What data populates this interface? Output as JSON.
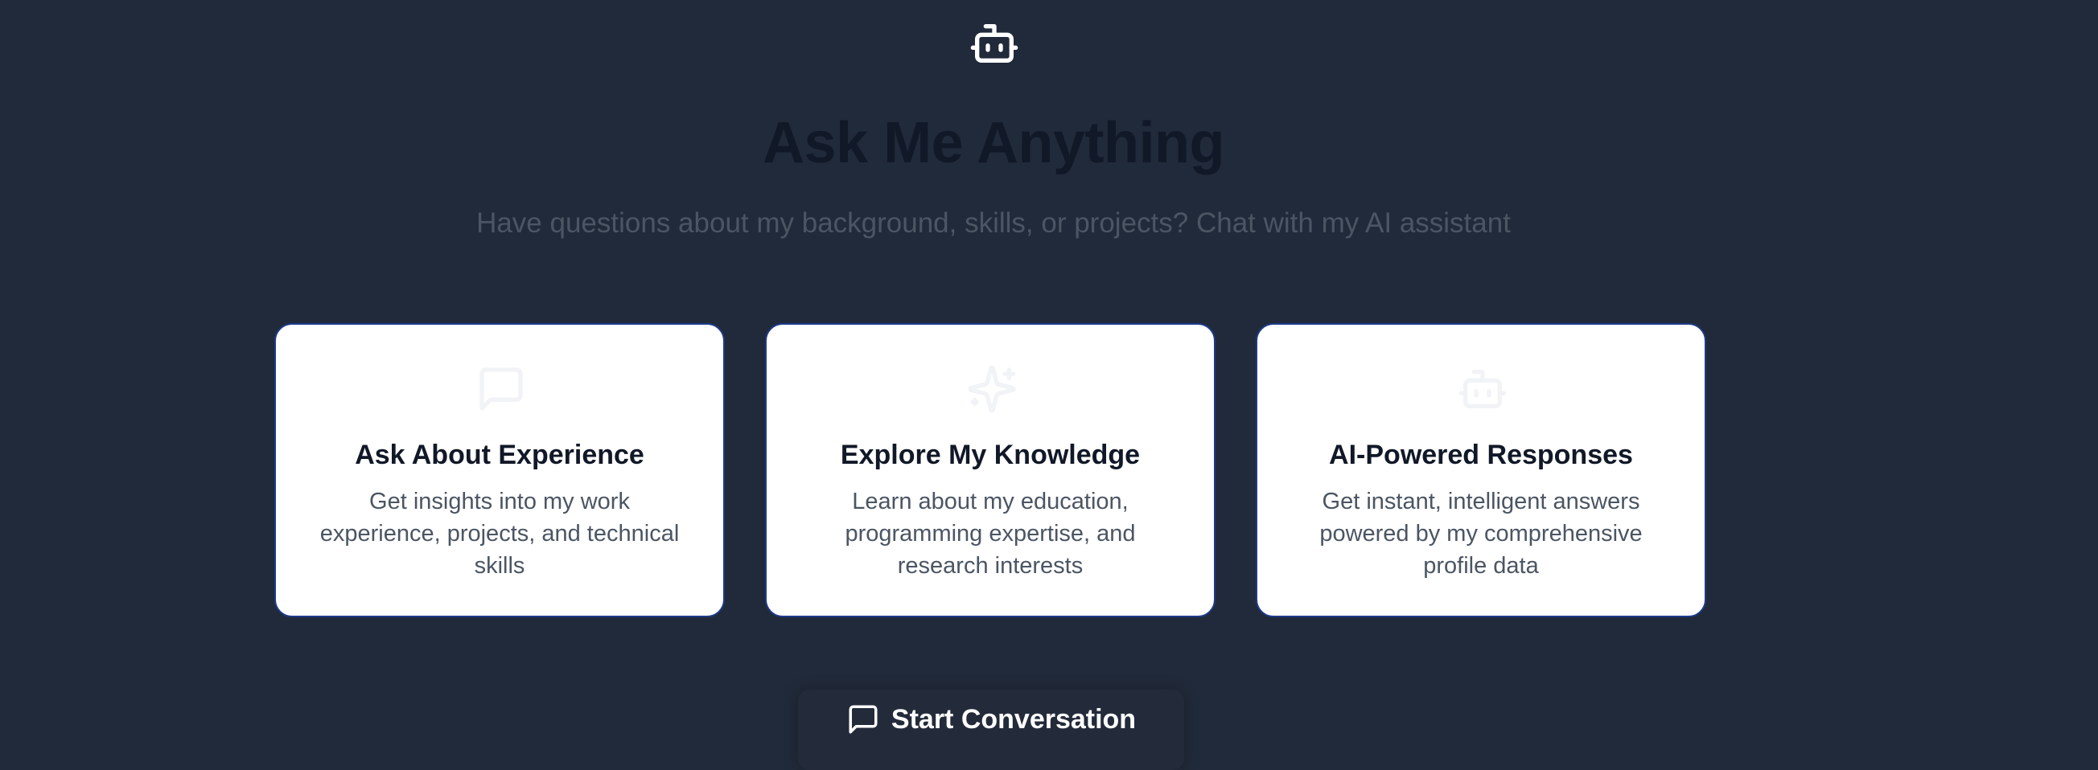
{
  "hero": {
    "icon": "bot-icon",
    "title": "Ask Me Anything",
    "subtitle": "Have questions about my background, skills, or projects? Chat with my AI assistant"
  },
  "cards": [
    {
      "icon": "message-square-icon",
      "title": "Ask About Experience",
      "description": "Get insights into my work experience, projects, and technical skills"
    },
    {
      "icon": "sparkles-icon",
      "title": "Explore My Knowledge",
      "description": "Learn about my education, programming expertise, and research interests"
    },
    {
      "icon": "bot-icon",
      "title": "AI-Powered Responses",
      "description": "Get instant, intelligent answers powered by my comprehensive profile data"
    }
  ],
  "cta": {
    "icon": "message-square-icon",
    "label": "Start Conversation"
  },
  "colors": {
    "background": "#212a3a",
    "card_background": "#ffffff",
    "card_border": "#1e3a8a",
    "title": "#111827",
    "muted_text": "#4b5563",
    "icon_faded": "#f1f3f6"
  }
}
